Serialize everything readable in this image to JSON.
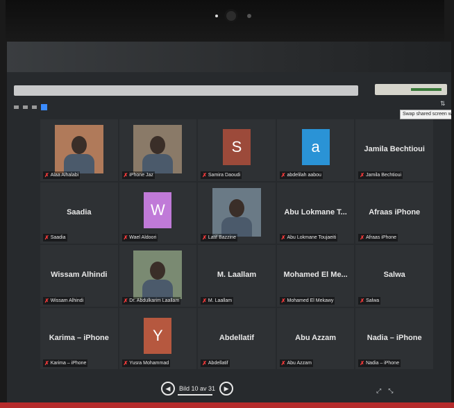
{
  "tabs": [
    "",
    "",
    ""
  ],
  "tooltip": "Swap shared screen with video",
  "participants": [
    {
      "name": "Alaa Alhalabi",
      "kind": "video",
      "bg": "#b07a5a"
    },
    {
      "name": "iPhone Jaz",
      "kind": "video",
      "bg": "#8a7a68"
    },
    {
      "name": "Samira Daoudi",
      "kind": "avatar",
      "letter": "S",
      "color": "#9c4a3a"
    },
    {
      "name": "abdelilah aabou",
      "kind": "avatar",
      "letter": "a",
      "color": "#2a93d6"
    },
    {
      "name": "Jamila Bechtioui",
      "kind": "name"
    },
    {
      "name": "Saadia",
      "kind": "name"
    },
    {
      "name": "Wael Aldoori",
      "kind": "avatar",
      "letter": "W",
      "color": "#c07ad8"
    },
    {
      "name": "Latif Bazzine",
      "kind": "video",
      "bg": "#6a7a86"
    },
    {
      "name": "Abu Lokmane Toujaeiti",
      "short": "Abu Lokmane T...",
      "kind": "name"
    },
    {
      "name": "Afraas iPhone",
      "kind": "name"
    },
    {
      "name": "Wissam Alhindi",
      "kind": "name"
    },
    {
      "name": "Dr. Abdulkarim Laallam",
      "kind": "video",
      "bg": "#7a8a72"
    },
    {
      "name": "M. Laallam",
      "kind": "name"
    },
    {
      "name": "Mohamed El Mekawy",
      "short": "Mohamed El Me...",
      "kind": "name"
    },
    {
      "name": "Salwa",
      "kind": "name"
    },
    {
      "name": "Karima – iPhone",
      "kind": "name"
    },
    {
      "name": "Yusra Mohammad",
      "kind": "avatar",
      "letter": "Y",
      "color": "#b6583f"
    },
    {
      "name": "Abdellatif",
      "kind": "name"
    },
    {
      "name": "Abu Azzam",
      "kind": "name"
    },
    {
      "name": "Nadia – iPhone",
      "kind": "name"
    }
  ],
  "pager": {
    "text": "Bild 10 av 31"
  },
  "icons": {
    "mic": "mic-muted-icon",
    "prev": "chevron-left-icon",
    "next": "chevron-right-icon"
  }
}
